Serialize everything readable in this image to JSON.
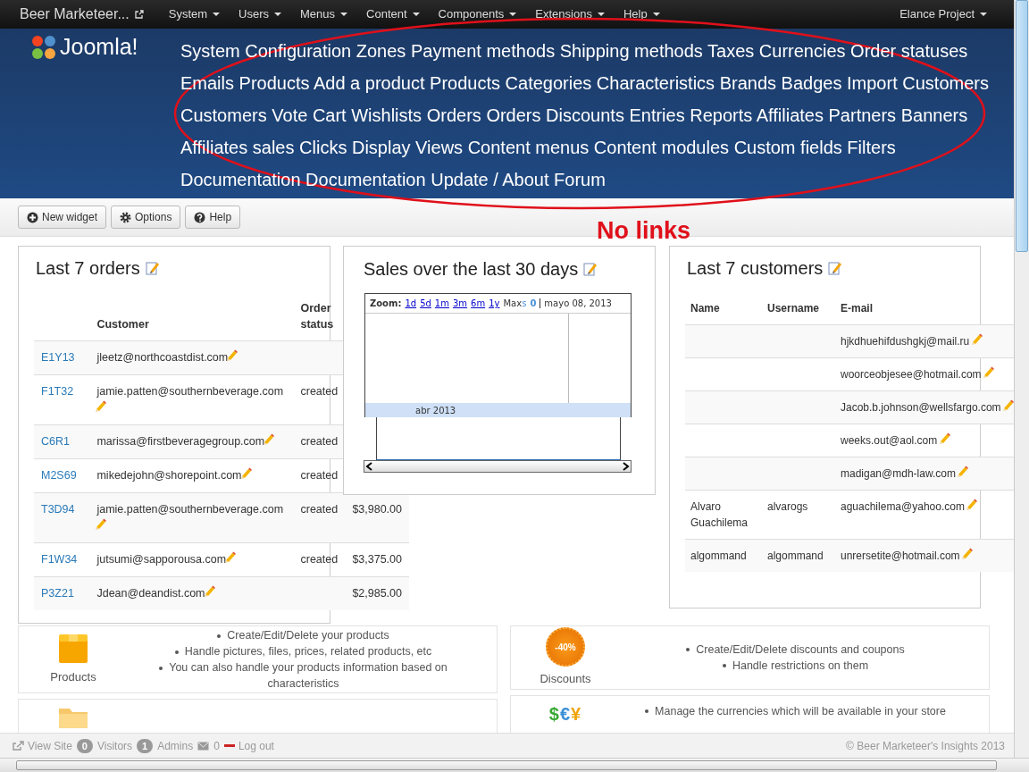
{
  "navbar": {
    "brand": "Beer Marketeer...",
    "menus": [
      {
        "label": "System"
      },
      {
        "label": "Users"
      },
      {
        "label": "Menus"
      },
      {
        "label": "Content"
      },
      {
        "label": "Components"
      },
      {
        "label": "Extensions"
      },
      {
        "label": "Help"
      }
    ],
    "right_menu": "Elance Project"
  },
  "header": {
    "logo_text": "Joomla!",
    "links": [
      "System",
      "Configuration",
      "Zones",
      "Payment methods",
      "Shipping methods",
      "Taxes",
      "Currencies",
      "Order statuses",
      "Emails",
      "Products",
      "Add a product",
      "Products",
      "Categories",
      "Characteristics",
      "Brands",
      "Badges",
      "Import",
      "Customers",
      "Customers",
      "Vote",
      "Cart",
      "Wishlists",
      "Orders",
      "Orders",
      "Discounts",
      "Entries",
      "Reports",
      "Affiliates",
      "Partners",
      "Banners",
      "Affiliates sales",
      "Clicks",
      "Display",
      "Views",
      "Content menus",
      "Content modules",
      "Custom fields",
      "Filters",
      "Documentation",
      "Documentation",
      "Update / About",
      "Forum"
    ]
  },
  "annotation": {
    "text": "No links"
  },
  "toolbar": {
    "buttons": [
      {
        "kind": "add",
        "label": "New widget"
      },
      {
        "kind": "settings",
        "label": "Options"
      },
      {
        "kind": "help",
        "label": "Help"
      }
    ]
  },
  "orders_widget": {
    "title": "Last 7 orders",
    "columns": [
      "Customer",
      "Order status"
    ],
    "rows": [
      {
        "id": "E1Y13",
        "customer": "jleetz@northcoastdist.com"
      },
      {
        "id": "F1T32",
        "customer": "jamie.patten@southernbeverage.com",
        "status": "created"
      },
      {
        "id": "C6R1",
        "customer": "marissa@firstbeveragegroup.com",
        "status": "created"
      },
      {
        "id": "M2S69",
        "customer": "mikedejohn@shorepoint.com",
        "status": "created"
      },
      {
        "id": "T3D94",
        "customer": "jamie.patten@southernbeverage.com",
        "status": "created",
        "amount": "$3,980.00"
      },
      {
        "id": "F1W34",
        "customer": "jutsumi@sapporousa.com",
        "status": "created",
        "amount": "$3,375.00"
      },
      {
        "id": "P3Z21",
        "customer": "Jdean@deandist.com",
        "amount": "$2,985.00"
      }
    ]
  },
  "chart_widget": {
    "title": "Sales over the last 30 days",
    "zoom_label": "Zoom:",
    "zoom_links": [
      "1d",
      "5d",
      "1m",
      "3m",
      "6m",
      "1y"
    ],
    "max_label": "Max",
    "series_label": "s",
    "series_value": "0",
    "date": "mayo 08, 2013",
    "period_label": "abr 2013"
  },
  "customers_widget": {
    "title": "Last 7 customers",
    "columns": [
      "Name",
      "Username",
      "E-mail"
    ],
    "rows": [
      {
        "email": "hjkdhuehifdushgkj@mail.ru"
      },
      {
        "email": "woorceobjesee@hotmail.com"
      },
      {
        "email": "Jacob.b.johnson@wellsfargo.com"
      },
      {
        "email": "weeks.out@aol.com"
      },
      {
        "email": "madigan@mdh-law.com"
      },
      {
        "name": "Alvaro Guachilema",
        "username": "alvarogs",
        "email": "aguachilema@yahoo.com"
      },
      {
        "name": "algommand",
        "username": "algommand",
        "email": "unrersetite@hotmail.com"
      }
    ]
  },
  "features": {
    "left": [
      {
        "kind": "products",
        "label": "Products",
        "bullets": [
          "Create/Edit/Delete your products",
          "Handle pictures, files, prices, related products, etc",
          "You can also handle your products information based on characteristics"
        ]
      },
      {
        "kind": "folder"
      }
    ],
    "right": [
      {
        "kind": "discounts",
        "label": "Discounts",
        "badge_text": "-40%",
        "bullets": [
          "Create/Edit/Delete discounts and coupons",
          "Handle restrictions on them"
        ]
      },
      {
        "kind": "currencies",
        "icon_glyphs": "$€¥",
        "bullets": [
          "Manage the currencies which will be available in your store"
        ]
      }
    ]
  },
  "footer": {
    "view_site": "View Site",
    "visitors_count": "0",
    "visitors_label": "Visitors",
    "admins_count": "1",
    "admins_label": "Admins",
    "messages_count": "0",
    "logout": "Log out",
    "copyright": "© Beer Marketeer's Insights 2013"
  }
}
